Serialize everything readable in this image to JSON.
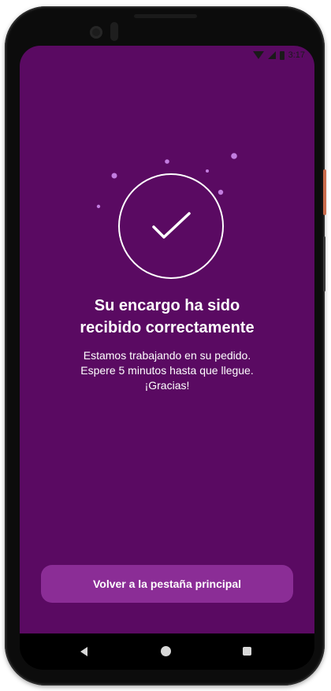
{
  "status_bar": {
    "time": "3:17",
    "icons": [
      "wifi-icon",
      "signal-icon",
      "battery-icon"
    ]
  },
  "confirmation": {
    "icon": "check-circle-icon",
    "title_line1": "Su encargo ha sido",
    "title_line2": "recibido correctamente",
    "message_line1": "Estamos trabajando en su pedido.",
    "message_line2": "Espere 5 minutos hasta que llegue.",
    "message_line3": "¡Gracias!"
  },
  "actions": {
    "back_to_main_label": "Volver a la pestaña principal"
  },
  "nav_bar": {
    "icons": [
      "back-icon",
      "home-icon",
      "recent-apps-icon"
    ]
  },
  "colors": {
    "screen_background": "#5a0a62",
    "button_background": "#8b2d96",
    "decor_dots": "#c27de0",
    "text": "#ffffff"
  }
}
